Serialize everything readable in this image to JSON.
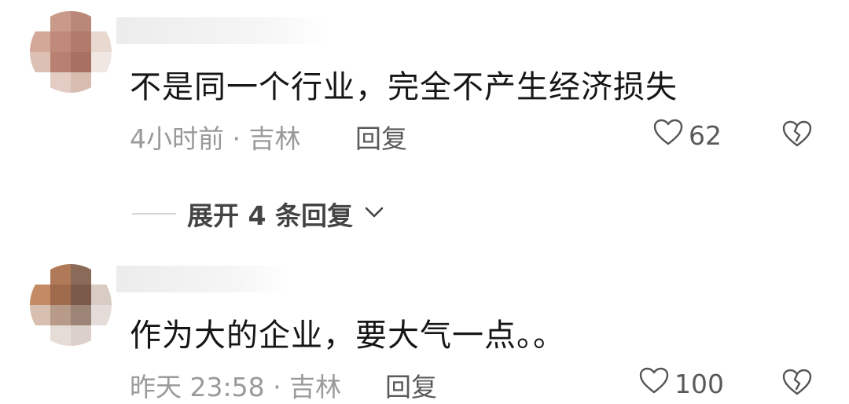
{
  "comments": [
    {
      "content": "不是同一个行业，完全不产生经济损失",
      "meta": "4小时前 · 吉林",
      "reply_label": "回复",
      "likes": "62",
      "avatar_colors": [
        "#ffffff",
        "#c99a8a",
        "#b98878",
        "#ffffff",
        "#d3a898",
        "#c08a7a",
        "#b27a6a",
        "#e8d8d0",
        "#ddc0b4",
        "#b88070",
        "#a87060",
        "#f0e6e2",
        "#ffffff",
        "#e2ccc4",
        "#d8bcb0",
        "#ffffff"
      ]
    },
    {
      "content": "作为大的企业，要大气一点。。",
      "meta": "昨天 23:58 · 吉林",
      "reply_label": "回复",
      "likes": "100",
      "avatar_colors": [
        "#ffffff",
        "#b07a58",
        "#8a6a58",
        "#ffffff",
        "#c48a64",
        "#a06a4c",
        "#7c5a4a",
        "#d8ccc4",
        "#d8c0b0",
        "#b89a88",
        "#9c8476",
        "#e4dcd8",
        "#ffffff",
        "#e6dcd6",
        "#dcd0ca",
        "#ffffff"
      ]
    }
  ],
  "expand": {
    "label": "展开 4 条回复"
  },
  "colors": {
    "meta": "#9a9a9a",
    "text": "#161616",
    "icon": "#555555"
  }
}
